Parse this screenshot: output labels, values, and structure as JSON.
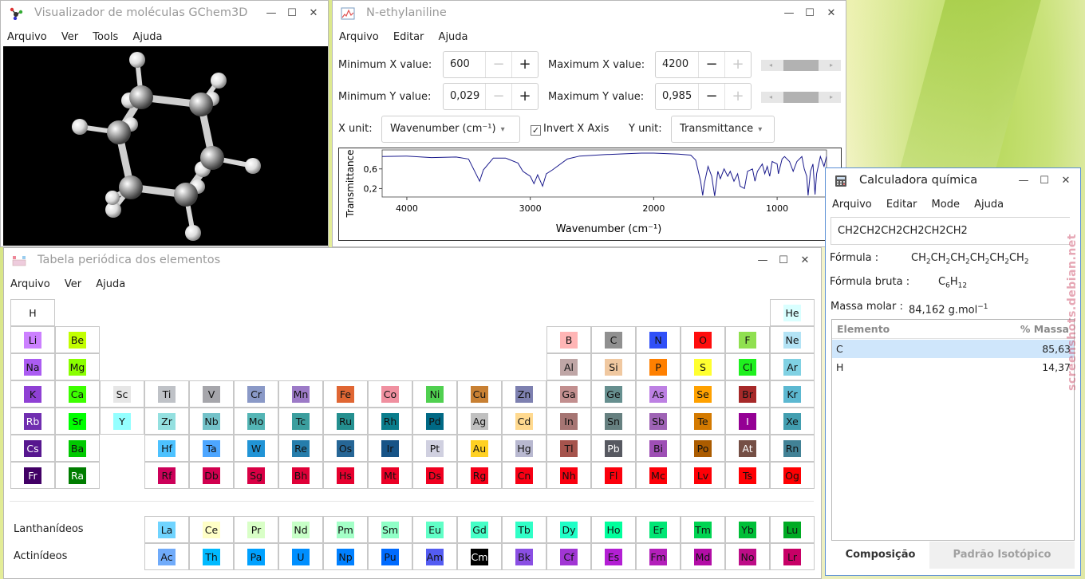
{
  "molecule_window": {
    "title": "Visualizador de moléculas GChem3D",
    "menu": [
      "Arquivo",
      "Ver",
      "Tools",
      "Ajuda"
    ]
  },
  "spectrum_window": {
    "title": "N-ethylaniline",
    "menu": [
      "Arquivo",
      "Editar",
      "Ajuda"
    ],
    "min_x_label": "Minimum X value:",
    "min_x_value": "600",
    "max_x_label": "Maximum X value:",
    "max_x_value": "4200",
    "min_y_label": "Minimum Y value:",
    "min_y_value": "0,029",
    "max_y_label": "Maximum Y value:",
    "max_y_value": "0,985",
    "x_unit_label": "X unit:",
    "x_unit_value": "Wavenumber (cm⁻¹)",
    "invert_label": "Invert X Axis",
    "invert_checked": true,
    "y_unit_label": "Y unit:",
    "y_unit_value": "Transmittance",
    "min_slider_level": 0.45,
    "max_slider_level": 0.45,
    "line_color": "#1a1a8c"
  },
  "chart_data": {
    "type": "line",
    "xlabel": "Wavenumber (cm⁻¹)",
    "ylabel": "Transmittance",
    "xlim": [
      4200,
      600
    ],
    "ylim": [
      0.029,
      0.985
    ],
    "x_ticks": [
      "4000",
      "3000",
      "2000",
      "1000"
    ],
    "y_ticks": [
      "0,6",
      "0,2"
    ],
    "series": [
      {
        "x": [
          4200,
          4000,
          3800,
          3600,
          3500,
          3450,
          3410,
          3380,
          3300,
          3200,
          3100,
          3060,
          3030,
          3000,
          2970,
          2940,
          2900,
          2870,
          2820,
          2700,
          2600,
          2400,
          2200,
          2100,
          2000,
          1900,
          1800,
          1700,
          1660,
          1620,
          1603,
          1590,
          1560,
          1530,
          1506,
          1480,
          1460,
          1430,
          1400,
          1380,
          1350,
          1320,
          1300,
          1265,
          1240,
          1200,
          1180,
          1160,
          1120,
          1100,
          1080,
          1060,
          1040,
          1000,
          990,
          960,
          940,
          900,
          870,
          840,
          800,
          780,
          760,
          749,
          730,
          710,
          693,
          680,
          650,
          620,
          600
        ],
        "y": [
          0.85,
          0.86,
          0.83,
          0.84,
          0.8,
          0.55,
          0.35,
          0.58,
          0.82,
          0.82,
          0.72,
          0.55,
          0.5,
          0.45,
          0.3,
          0.48,
          0.25,
          0.5,
          0.58,
          0.8,
          0.86,
          0.89,
          0.91,
          0.92,
          0.92,
          0.91,
          0.9,
          0.88,
          0.78,
          0.35,
          0.06,
          0.3,
          0.65,
          0.45,
          0.05,
          0.55,
          0.4,
          0.6,
          0.45,
          0.55,
          0.35,
          0.5,
          0.25,
          0.2,
          0.55,
          0.6,
          0.35,
          0.55,
          0.7,
          0.5,
          0.65,
          0.45,
          0.75,
          0.7,
          0.5,
          0.8,
          0.85,
          0.75,
          0.55,
          0.75,
          0.85,
          0.6,
          0.45,
          0.06,
          0.55,
          0.7,
          0.08,
          0.5,
          0.85,
          0.65,
          0.85
        ]
      }
    ]
  },
  "periodic_window": {
    "title": "Tabela periódica dos elementos",
    "menu": [
      "Arquivo",
      "Ver",
      "Ajuda"
    ],
    "lanthanides_label": "Lanthanídeos",
    "actinides_label": "Actinídeos",
    "main": [
      [
        [
          "H",
          "#ffffff"
        ],
        null,
        null,
        null,
        null,
        null,
        null,
        null,
        null,
        null,
        null,
        null,
        null,
        null,
        null,
        null,
        null,
        [
          "He",
          "#d9ffff"
        ]
      ],
      [
        [
          "Li",
          "#cc80ff"
        ],
        [
          "Be",
          "#c2ff00"
        ],
        null,
        null,
        null,
        null,
        null,
        null,
        null,
        null,
        null,
        null,
        [
          "B",
          "#ffb5b5"
        ],
        [
          "C",
          "#909090"
        ],
        [
          "N",
          "#3050f8"
        ],
        [
          "O",
          "#ff0d0d"
        ],
        [
          "F",
          "#90e050"
        ],
        [
          "Ne",
          "#b3e3f5"
        ]
      ],
      [
        [
          "Na",
          "#ab5cf2"
        ],
        [
          "Mg",
          "#8aff00"
        ],
        null,
        null,
        null,
        null,
        null,
        null,
        null,
        null,
        null,
        null,
        [
          "Al",
          "#bfa6a6"
        ],
        [
          "Si",
          "#f0c8a0"
        ],
        [
          "P",
          "#ff8000"
        ],
        [
          "S",
          "#ffff30"
        ],
        [
          "Cl",
          "#1ff01f"
        ],
        [
          "Ar",
          "#80d1e3"
        ]
      ],
      [
        [
          "K",
          "#8f40d4"
        ],
        [
          "Ca",
          "#3dff00"
        ],
        [
          "Sc",
          "#e6e6e6"
        ],
        [
          "Ti",
          "#bfc2c7"
        ],
        [
          "V",
          "#a6a6ab"
        ],
        [
          "Cr",
          "#8a99c7"
        ],
        [
          "Mn",
          "#9c7ac7"
        ],
        [
          "Fe",
          "#e06633"
        ],
        [
          "Co",
          "#f090a0"
        ],
        [
          "Ni",
          "#50d050"
        ],
        [
          "Cu",
          "#c88033"
        ],
        [
          "Zn",
          "#7d80b0"
        ],
        [
          "Ga",
          "#c28f8f"
        ],
        [
          "Ge",
          "#668f8f"
        ],
        [
          "As",
          "#bd80e3"
        ],
        [
          "Se",
          "#ffa100"
        ],
        [
          "Br",
          "#a62929"
        ],
        [
          "Kr",
          "#5cb8d1"
        ]
      ],
      [
        [
          "Rb",
          "#702eb0"
        ],
        [
          "Sr",
          "#00ff00"
        ],
        [
          "Y",
          "#94ffff"
        ],
        [
          "Zr",
          "#94e0e0"
        ],
        [
          "Nb",
          "#73c2c9"
        ],
        [
          "Mo",
          "#54b5b5"
        ],
        [
          "Tc",
          "#3b9e9e"
        ],
        [
          "Ru",
          "#248f8f"
        ],
        [
          "Rh",
          "#0a7d8c"
        ],
        [
          "Pd",
          "#006985"
        ],
        [
          "Ag",
          "#c0c0c0"
        ],
        [
          "Cd",
          "#ffd98f"
        ],
        [
          "In",
          "#a67573"
        ],
        [
          "Sn",
          "#668080"
        ],
        [
          "Sb",
          "#9e63b5"
        ],
        [
          "Te",
          "#d47a00"
        ],
        [
          "I",
          "#940094"
        ],
        [
          "Xe",
          "#429eb0"
        ]
      ],
      [
        [
          "Cs",
          "#57178f"
        ],
        [
          "Ba",
          "#00c900"
        ],
        null,
        [
          "Hf",
          "#4dc2ff"
        ],
        [
          "Ta",
          "#4da6ff"
        ],
        [
          "W",
          "#2194d6"
        ],
        [
          "Re",
          "#267dab"
        ],
        [
          "Os",
          "#266696"
        ],
        [
          "Ir",
          "#175487"
        ],
        [
          "Pt",
          "#d0d0e0"
        ],
        [
          "Au",
          "#ffd123"
        ],
        [
          "Hg",
          "#b8b8d0"
        ],
        [
          "Tl",
          "#a6544d"
        ],
        [
          "Pb",
          "#575961"
        ],
        [
          "Bi",
          "#9e4fb5"
        ],
        [
          "Po",
          "#ab5c00"
        ],
        [
          "At",
          "#754f45"
        ],
        [
          "Rn",
          "#428296"
        ]
      ],
      [
        [
          "Fr",
          "#420066"
        ],
        [
          "Ra",
          "#007d00"
        ],
        null,
        [
          "Rf",
          "#cc0059"
        ],
        [
          "Db",
          "#d1004f"
        ],
        [
          "Sg",
          "#d90045"
        ],
        [
          "Bh",
          "#e00038"
        ],
        [
          "Hs",
          "#e6002e"
        ],
        [
          "Mt",
          "#eb0026"
        ],
        [
          "Ds",
          "#f00020"
        ],
        [
          "Rg",
          "#f5001a"
        ],
        [
          "Cn",
          "#f80014"
        ],
        [
          "Nh",
          "#fa0010"
        ],
        [
          "Fl",
          "#fc000c"
        ],
        [
          "Mc",
          "#fd0009"
        ],
        [
          "Lv",
          "#fe0006"
        ],
        [
          "Ts",
          "#ff0004"
        ],
        [
          "Og",
          "#ff0002"
        ]
      ]
    ],
    "lanthanides": [
      [
        "La",
        "#70d4ff"
      ],
      [
        "Ce",
        "#ffffc7"
      ],
      [
        "Pr",
        "#d9ffc7"
      ],
      [
        "Nd",
        "#c7ffc7"
      ],
      [
        "Pm",
        "#a3ffc7"
      ],
      [
        "Sm",
        "#8fffc7"
      ],
      [
        "Eu",
        "#61ffc7"
      ],
      [
        "Gd",
        "#45ffc7"
      ],
      [
        "Tb",
        "#30ffc7"
      ],
      [
        "Dy",
        "#1fffc7"
      ],
      [
        "Ho",
        "#00ff9c"
      ],
      [
        "Er",
        "#00e675"
      ],
      [
        "Tm",
        "#00d452"
      ],
      [
        "Yb",
        "#00bf38"
      ],
      [
        "Lu",
        "#00ab24"
      ]
    ],
    "actinides": [
      [
        "Ac",
        "#70abfa"
      ],
      [
        "Th",
        "#00baff"
      ],
      [
        "Pa",
        "#00a1ff"
      ],
      [
        "U",
        "#008fff"
      ],
      [
        "Np",
        "#0080ff"
      ],
      [
        "Pu",
        "#006bff"
      ],
      [
        "Am",
        "#545cf2"
      ],
      [
        "Cm",
        "#000000"
      ],
      [
        "Bk",
        "#8a4fe3"
      ],
      [
        "Cf",
        "#a136d4"
      ],
      [
        "Es",
        "#b31fd4"
      ],
      [
        "Fm",
        "#b31fba"
      ],
      [
        "Md",
        "#b30da6"
      ],
      [
        "No",
        "#bd0d87"
      ],
      [
        "Lr",
        "#c70066"
      ]
    ]
  },
  "calc_window": {
    "title": "Calculadora química",
    "menu": [
      "Arquivo",
      "Editar",
      "Mode",
      "Ajuda"
    ],
    "input_value": "CH2CH2CH2CH2CH2CH2",
    "formula_label": "Fórmula :",
    "formula_parts": [
      [
        "CH",
        "2"
      ],
      [
        "CH",
        "2"
      ],
      [
        "CH",
        "2"
      ],
      [
        "CH",
        "2"
      ],
      [
        "CH",
        "2"
      ],
      [
        "CH",
        "2"
      ]
    ],
    "raw_label": "Fórmula bruta :",
    "raw_parts": [
      [
        "C",
        "6"
      ],
      [
        "H",
        "12"
      ]
    ],
    "mass_label": "Massa molar :",
    "mass_value": "84,162 g.mol",
    "mass_unit_exp": "−1",
    "columns": [
      "Elemento",
      "% Massa"
    ],
    "rows": [
      {
        "element": "C",
        "mass": "85,63"
      },
      {
        "element": "H",
        "mass": "14,37"
      }
    ],
    "tabs": [
      "Composição",
      "Padrão Isotópico"
    ]
  },
  "watermark": "screenshots.debian.net",
  "colors": {
    "selection": "#cfe6fb",
    "active_border": "#5a8fd6"
  }
}
